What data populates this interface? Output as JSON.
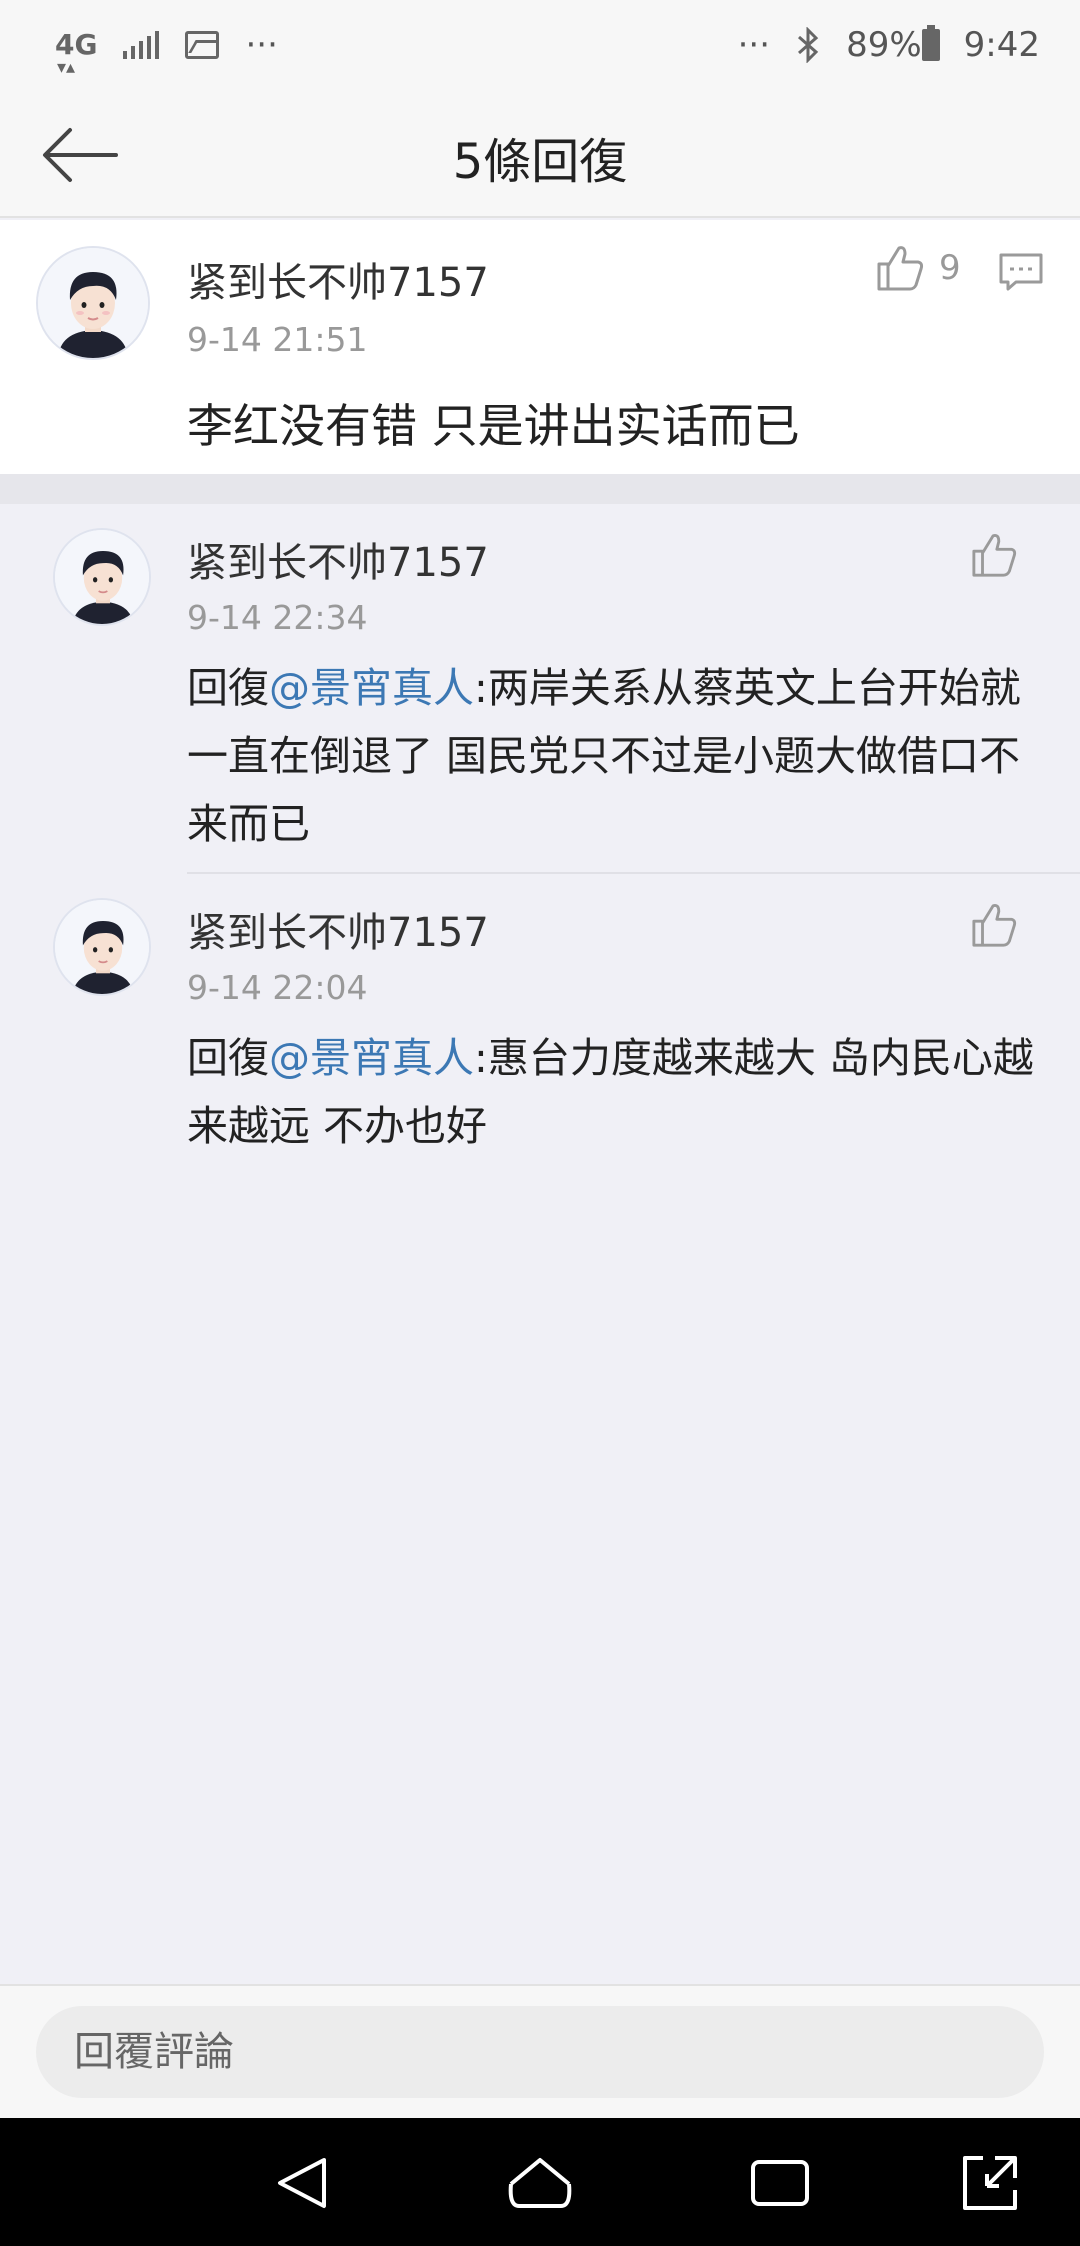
{
  "status_bar": {
    "network": "4G",
    "more_left": "···",
    "more_right": "···",
    "battery": "89%",
    "time": "9:42"
  },
  "header": {
    "title": "5條回復"
  },
  "main_comment": {
    "username": "紧到长不帅7157",
    "time": "9-14 21:51",
    "text": "李红没有错  只是讲出实话而已",
    "likes": "9"
  },
  "replies": [
    {
      "username": "紧到长不帅7157",
      "time": "9-14 22:34",
      "prefix": "回復",
      "mention": "@景宵真人",
      "text": ":两岸关系从蔡英文上台开始就一直在倒退了    国民党只不过是小题大做借口不来而已"
    },
    {
      "username": "紧到长不帅7157",
      "time": "9-14 22:04",
      "prefix": "回復",
      "mention": "@景宵真人",
      "text": ":惠台力度越来越大    岛内民心越来越远    不办也好"
    }
  ],
  "input": {
    "placeholder": "回覆評論"
  },
  "colors": {
    "mention": "#3c78b4",
    "background": "#f0f0f6"
  }
}
